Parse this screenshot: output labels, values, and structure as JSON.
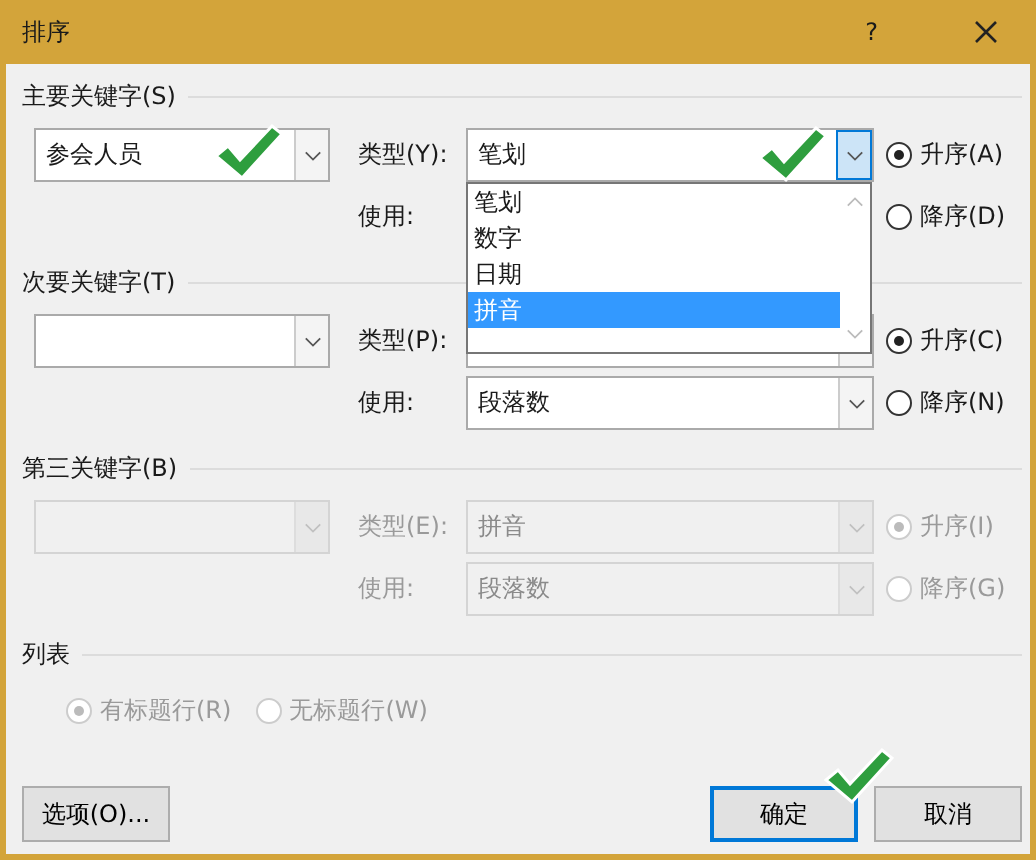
{
  "window": {
    "title": "排序",
    "help": "?"
  },
  "sort_keys": [
    {
      "heading": "主要关键字(S)",
      "disabled": false,
      "key_value": "参会人员",
      "key_check": true,
      "type_label": "类型(Y):",
      "type_value": "笔划",
      "type_open": true,
      "type_check": true,
      "using_label": "使用:",
      "type_options": [
        {
          "label": "笔划",
          "selected": false
        },
        {
          "label": "数字",
          "selected": false
        },
        {
          "label": "日期",
          "selected": false
        },
        {
          "label": "拼音",
          "selected": true
        }
      ],
      "order": [
        {
          "label": "升序(A)",
          "selected": true
        },
        {
          "label": "降序(D)",
          "selected": false
        }
      ]
    },
    {
      "heading": "次要关键字(T)",
      "disabled": false,
      "type_label": "类型(P):",
      "type_open": false,
      "using_label": "使用:",
      "using_value": "段落数",
      "order": [
        {
          "label": "升序(C)",
          "selected": true
        },
        {
          "label": "降序(N)",
          "selected": false
        }
      ]
    },
    {
      "heading": "第三关键字(B)",
      "disabled": true,
      "type_label": "类型(E):",
      "type_value": "拼音",
      "type_open": false,
      "using_label": "使用:",
      "using_value": "段落数",
      "order": [
        {
          "label": "升序(I)",
          "selected": true
        },
        {
          "label": "降序(G)",
          "selected": false
        }
      ]
    }
  ],
  "list_section": {
    "heading": "列表",
    "disabled": true,
    "options": [
      {
        "label": "有标题行(R)",
        "selected": true
      },
      {
        "label": "无标题行(W)",
        "selected": false
      }
    ]
  },
  "buttons": [
    {
      "label": "选项(O)...",
      "default": false
    },
    {
      "label": "确定",
      "default": true,
      "check": true
    },
    {
      "label": "取消",
      "default": false
    }
  ]
}
